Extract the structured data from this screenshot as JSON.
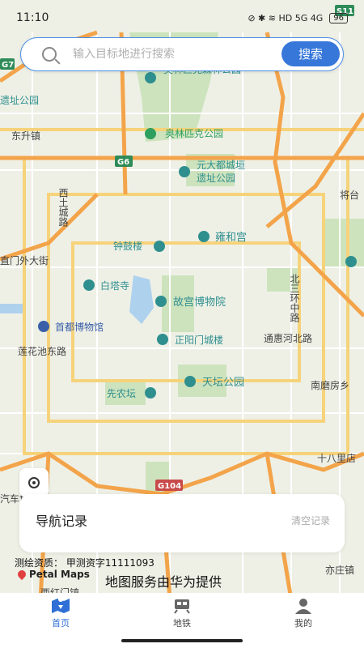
{
  "status": {
    "time": "11:10",
    "icons": "⊘ ✱ ≋ HD 5G 4G",
    "battery": "96"
  },
  "search": {
    "placeholder": "输入目标地进行搜索",
    "button": "搜索"
  },
  "map": {
    "roads_shields": [
      "G7",
      "G6",
      "S11",
      "G104"
    ],
    "labels": [
      "奥林匹克森林公园",
      "遗址公园",
      "东升镇",
      "奥林匹克公园",
      "元大都城垣",
      "遗址公园",
      "西土城路",
      "将台",
      "钟鼓楼",
      "雍和宫",
      "直门外大街",
      "北三环中路",
      "白塔寺",
      "故宫博物院",
      "首都博物馆",
      "正阳门城楼",
      "通惠河北路",
      "莲花池东路",
      "天坛公园",
      "南磨房乡",
      "先农坛",
      "十八里店",
      "汽车博",
      "亦庄镇",
      "西红门镇"
    ]
  },
  "history": {
    "title": "导航记录",
    "clear": "清空记录"
  },
  "credits": {
    "survey": "测绘资质：  甲测资字11111093",
    "brand": "Petal Maps",
    "provider": "地图服务由华为提供"
  },
  "tabs": [
    {
      "label": "首页",
      "icon": "home-map-icon"
    },
    {
      "label": "地铁",
      "icon": "subway-icon"
    },
    {
      "label": "我的",
      "icon": "profile-icon"
    }
  ],
  "colors": {
    "accent": "#3677d9",
    "road_orange": "#f3a44a",
    "road_yellow": "#f7d879",
    "park_green": "#cfe5c2"
  }
}
